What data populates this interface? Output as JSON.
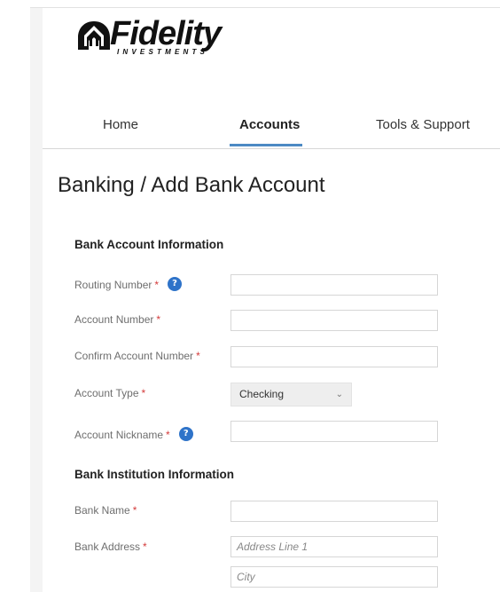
{
  "brand": {
    "name": "Fidelity",
    "sub": "INVESTMENTS"
  },
  "nav": {
    "home": "Home",
    "accounts": "Accounts",
    "tools": "Tools & Support",
    "active": "Accounts"
  },
  "page": {
    "title": "Banking / Add Bank Account"
  },
  "sections": {
    "account_info": "Bank Account Information",
    "institution_info": "Bank Institution Information"
  },
  "fields": {
    "routing_number": {
      "label": "Routing Number",
      "value": ""
    },
    "account_number": {
      "label": "Account Number",
      "value": ""
    },
    "confirm_account_number": {
      "label": "Confirm Account Number",
      "value": ""
    },
    "account_type": {
      "label": "Account Type",
      "value": "Checking"
    },
    "account_nickname": {
      "label": "Account Nickname",
      "value": ""
    },
    "bank_name": {
      "label": "Bank Name",
      "value": ""
    },
    "bank_address": {
      "label": "Bank Address",
      "line1_placeholder": "Address Line 1",
      "city_placeholder": "City"
    }
  },
  "required_marker": "*",
  "help_glyph": "?",
  "icons": {
    "help": "help-icon",
    "dropdown": "chevron-down-icon",
    "logo": "pyramid-logo-icon"
  },
  "colors": {
    "accent": "#4c8ac4",
    "help_icon": "#2e73c9",
    "required": "#d43b3b"
  }
}
